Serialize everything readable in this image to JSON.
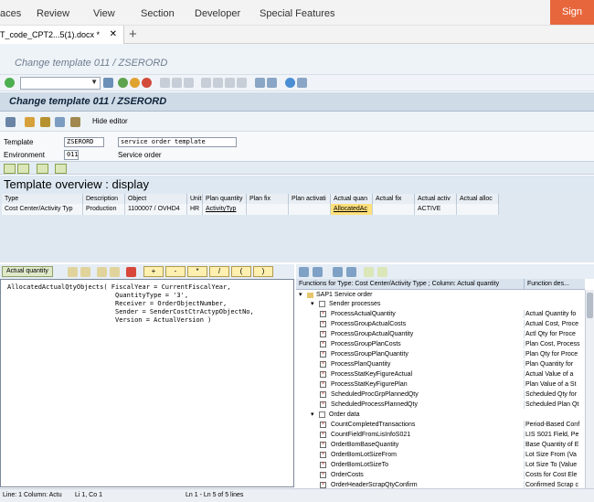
{
  "word": {
    "tabs": [
      "aces",
      "Review",
      "View",
      "Section",
      "Developer",
      "Special Features"
    ],
    "sign_in": "Sign",
    "doc_tab": "T_code_CPT2...5(1).docx *",
    "close": "✕",
    "new_tab": "+"
  },
  "sap": {
    "window_title": "Change template 011 / ZSERORD",
    "screen_title": "Change template 011 / ZSERORD",
    "hide_editor": "Hide editor",
    "template_label": "Template",
    "template_value": "ZSERORD",
    "template_desc": "service order template",
    "environment_label": "Environment",
    "environment_value": "011",
    "environment_desc": "Service order",
    "overview_title": "Template overview : display"
  },
  "grid": {
    "headers": [
      "Type",
      "Description",
      "Object",
      "Unit",
      "Plan quantity",
      "Plan fix",
      "Plan activati",
      "Actual quan",
      "Actual fix",
      "Actual activ",
      "Actual alloc"
    ],
    "row": [
      "Cost Center/Activity Typ",
      "Production",
      "1100007 / OVHD4",
      "HR",
      "ActivityTyp",
      "",
      "",
      "AllocatedAc",
      "",
      "ACTIVE",
      ""
    ]
  },
  "editor": {
    "active_button": "Actual quantity",
    "operators": [
      "+",
      "-",
      "*",
      "/",
      "(",
      ")"
    ],
    "code": "AllocatedActualQtyObjects( FiscalYear = CurrentFiscalYear,\n                            QuantityType = '3',\n                            Receiver = OrderObjectNumber,\n                            Sender = SenderCostCtrActypObjectNo,\n                            Version = ActualVersion )"
  },
  "functions": {
    "header_left": "Functions for Type: Cost Center/Activity Type ; Column: Actual quantity",
    "header_right": "Function des...",
    "root": "SAP1 Service order",
    "section1": "Sender processes",
    "section2": "Order data",
    "items1": [
      {
        "name": "ProcessActualQuantity",
        "desc": "Actual Quantity fo"
      },
      {
        "name": "ProcessGroupActualCosts",
        "desc": "Actual Cost, Proce"
      },
      {
        "name": "ProcessGroupActualQuantity",
        "desc": "Actl Qty for Proce"
      },
      {
        "name": "ProcessGroupPlanCosts",
        "desc": "Plan Cost, Process"
      },
      {
        "name": "ProcessGroupPlanQuantity",
        "desc": "Plan Qty for Proce"
      },
      {
        "name": "ProcessPlanQuantity",
        "desc": "Plan Quantity for"
      },
      {
        "name": "ProcessStatKeyFigureActual",
        "desc": "Actual Value of a"
      },
      {
        "name": "ProcessStatKeyFigurePlan",
        "desc": "Plan Value of a St"
      },
      {
        "name": "ScheduledProcGrpPlannedQty",
        "desc": "Scheduled Qty for"
      },
      {
        "name": "ScheduledProcessPlannedQty",
        "desc": "Scheduled Plan Qt"
      }
    ],
    "items2": [
      {
        "name": "CountCompletedTransactions",
        "desc": "Period-Based Conf"
      },
      {
        "name": "CountFieldFromLisInfoS021",
        "desc": "LIS S021 Field, Pe"
      },
      {
        "name": "OrderBomBaseQuantity",
        "desc": "Base Quantity of E"
      },
      {
        "name": "OrderBomLotSizeFrom",
        "desc": "Lot Size From (Va"
      },
      {
        "name": "OrderBomLotSizeTo",
        "desc": "Lot Size To (Value"
      },
      {
        "name": "OrderCosts",
        "desc": "Costs for Cost Ele"
      },
      {
        "name": "OrderHeaderScrapQtyConfirm",
        "desc": "Confirmed Scrap c"
      }
    ]
  },
  "status": {
    "left": "Line: 1 Column: Actu",
    "pos": "Li 1, Co 1",
    "lines": "Ln 1 - Ln 5 of 5 lines"
  }
}
